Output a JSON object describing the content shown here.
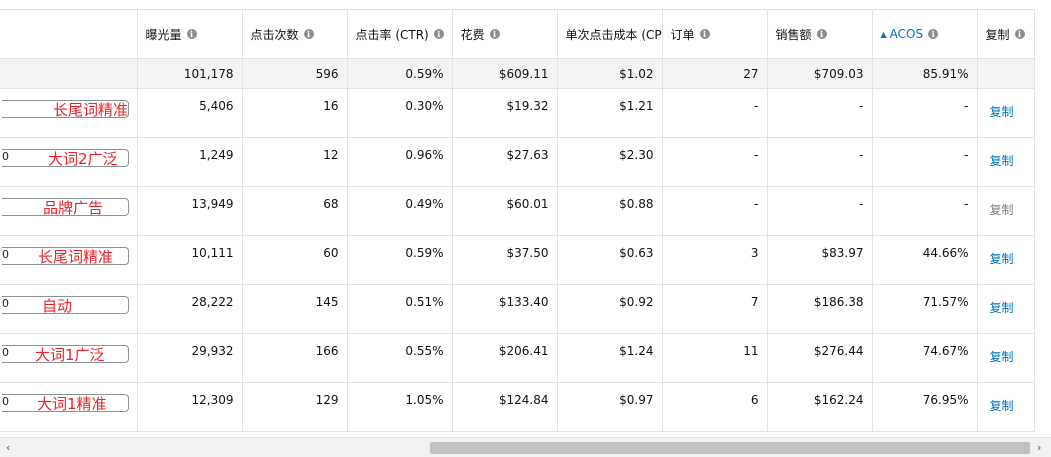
{
  "headers": [
    {
      "label": "",
      "info": false,
      "sort": false
    },
    {
      "label": "曝光量",
      "info": true,
      "sort": false
    },
    {
      "label": "点击次数",
      "info": true,
      "sort": false
    },
    {
      "label": "点击率 (CTR)",
      "info": true,
      "sort": false
    },
    {
      "label": "花费",
      "info": true,
      "sort": false
    },
    {
      "label": "单次点击成本 (CPC)",
      "info": false,
      "sort": false
    },
    {
      "label": "订单",
      "info": true,
      "sort": false
    },
    {
      "label": "销售额",
      "info": true,
      "sort": false
    },
    {
      "label": "ACOS",
      "info": true,
      "sort": true
    },
    {
      "label": "复制",
      "info": true,
      "sort": false
    }
  ],
  "sort_arrow": "▲",
  "info_glyph": "i",
  "summary": [
    "101,178",
    "596",
    "0.59%",
    "$609.11",
    "$1.02",
    "27",
    "$709.03",
    "85.91%"
  ],
  "rows": [
    {
      "prefix": "",
      "label": "长尾词精准",
      "values": [
        "5,406",
        "16",
        "0.30%",
        "$19.32",
        "$1.21",
        "-",
        "-",
        "-"
      ],
      "copy": "复制",
      "copy_enabled": true
    },
    {
      "prefix": "0",
      "label": "大词2广泛",
      "values": [
        "1,249",
        "12",
        "0.96%",
        "$27.63",
        "$2.30",
        "-",
        "-",
        "-"
      ],
      "copy": "复制",
      "copy_enabled": true
    },
    {
      "prefix": "",
      "label": "品牌广告",
      "values": [
        "13,949",
        "68",
        "0.49%",
        "$60.01",
        "$0.88",
        "-",
        "-",
        "-"
      ],
      "copy": "复制",
      "copy_enabled": false
    },
    {
      "prefix": "0",
      "label": "长尾词精准",
      "values": [
        "10,111",
        "60",
        "0.59%",
        "$37.50",
        "$0.63",
        "3",
        "$83.97",
        "44.66%"
      ],
      "copy": "复制",
      "copy_enabled": true
    },
    {
      "prefix": "0",
      "label": "自动",
      "values": [
        "28,222",
        "145",
        "0.51%",
        "$133.40",
        "$0.92",
        "7",
        "$186.38",
        "71.57%"
      ],
      "copy": "复制",
      "copy_enabled": true
    },
    {
      "prefix": "0",
      "label": "大词1广泛",
      "values": [
        "29,932",
        "166",
        "0.55%",
        "$206.41",
        "$1.24",
        "11",
        "$276.44",
        "74.67%"
      ],
      "copy": "复制",
      "copy_enabled": true
    },
    {
      "prefix": "0",
      "label": "大词1精准",
      "values": [
        "12,309",
        "129",
        "1.05%",
        "$124.84",
        "$0.97",
        "6",
        "$162.24",
        "76.95%"
      ],
      "copy": "复制",
      "copy_enabled": true
    }
  ],
  "scroll": {
    "left": "‹",
    "right": "›"
  },
  "colors": {
    "link": "#0073bb",
    "annotation": "#e8242a",
    "summary_bg": "#f3f3f3",
    "disabled": "#7d7d7d"
  }
}
